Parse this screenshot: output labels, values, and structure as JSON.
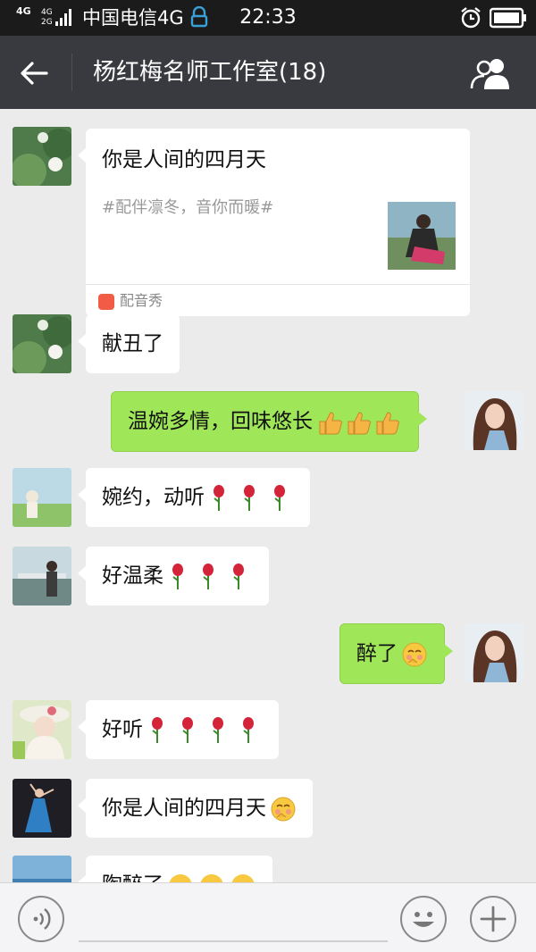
{
  "status": {
    "network_top": "4G",
    "network_bottom": "4G 2G",
    "carrier": "中国电信4G",
    "time": "22:33"
  },
  "header": {
    "title": "杨红梅名师工作室(18)"
  },
  "card": {
    "title": "你是人间的四月天",
    "desc": "#配伴凛冬，音你而暖#",
    "app": "配音秀"
  },
  "messages": [
    {
      "text": "献丑了"
    },
    {
      "text": "温婉多情，回味悠长"
    },
    {
      "text": "婉约，动听"
    },
    {
      "text": "好温柔"
    },
    {
      "text": "醉了"
    },
    {
      "text": "好听"
    },
    {
      "text": "你是人间的四月天"
    },
    {
      "text": "陶醉了"
    }
  ],
  "icons": [
    "back-arrow-icon",
    "group-members-icon",
    "voice-icon",
    "emoji-icon",
    "plus-icon",
    "thumbs-up-icon",
    "rose-icon",
    "blush-emoji-icon"
  ]
}
